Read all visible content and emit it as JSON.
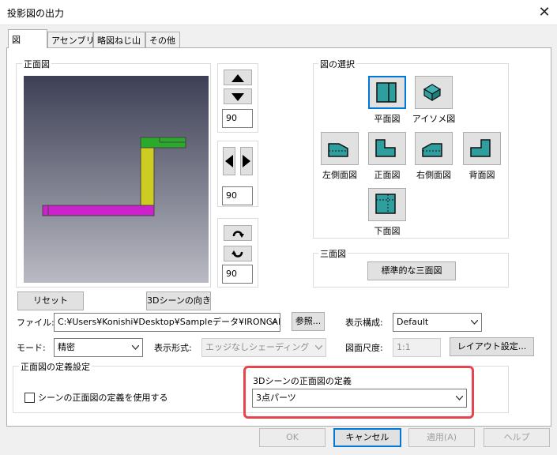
{
  "window": {
    "title": "投影図の出力",
    "close_glyph": "✕"
  },
  "tabs": [
    {
      "label": "図",
      "active": true
    },
    {
      "label": "アセンブリ"
    },
    {
      "label": "略図ねじ山"
    },
    {
      "label": "その他"
    }
  ],
  "front_view": {
    "group_label": "正面図"
  },
  "rotation": {
    "vertical_value": "90",
    "horizontal_value": "90",
    "spin_value": "90"
  },
  "buttons": {
    "reset": "リセット",
    "scene_orientation": "3Dシーンの向き",
    "browse": "参照...",
    "layout_settings": "レイアウト設定...",
    "standard_three_views": "標準的な三面図",
    "ok": "OK",
    "cancel": "キャンセル",
    "apply": "適用(A)",
    "help": "ヘルプ"
  },
  "view_selection": {
    "group_label": "図の選択",
    "views": {
      "plan": "平面図",
      "isometric": "アイソメ図",
      "left": "左側面図",
      "front": "正面図",
      "right": "右側面図",
      "back": "背面図",
      "bottom": "下面図"
    }
  },
  "three_views": {
    "group_label": "三面図"
  },
  "file": {
    "label": "ファイル:",
    "value": "C:¥Users¥Konishi¥Desktop¥Sampleデータ¥IRONCAD"
  },
  "display_config": {
    "label": "表示構成:",
    "value": "Default"
  },
  "mode": {
    "label": "モード:",
    "value": "精密"
  },
  "display_format": {
    "label": "表示形式:",
    "value": "エッジなしシェーディング"
  },
  "scale": {
    "label": "図面尺度:",
    "value": "1:1"
  },
  "front_definition": {
    "group_label": "正面図の定義設定",
    "checkbox_label": "シーンの正面図の定義を使用する",
    "scene_front_label": "3Dシーンの正面図の定義",
    "scene_front_value": "3点パーツ"
  },
  "colors": {
    "viewport_top": "#3d3f55",
    "viewport_bottom": "#b9bac3",
    "part_green": "#2aaa2a",
    "part_yellow": "#cccc22",
    "part_magenta": "#cc22cc",
    "highlight": "#e64550",
    "focus": "#0078d7",
    "icon_teal": "#2f9e9e"
  }
}
